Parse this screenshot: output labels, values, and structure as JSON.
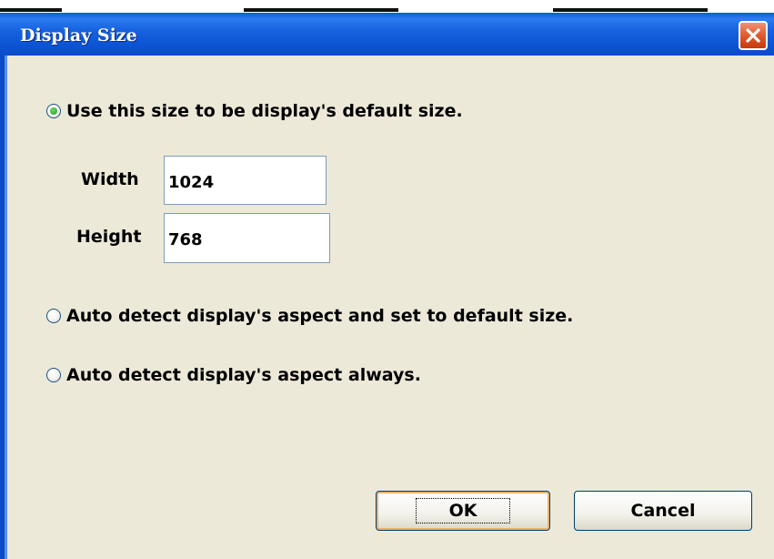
{
  "dialog": {
    "title": "Display Size",
    "close_icon": "close-icon"
  },
  "options": {
    "use_size_label": "Use this size to be display's default size.",
    "auto_default_label": "Auto detect display's aspect and set to default size.",
    "auto_always_label": "Auto detect display's aspect  always.",
    "selected": "use_size"
  },
  "size": {
    "width_label": "Width",
    "width_value": "1024",
    "height_label": "Height",
    "height_value": "768"
  },
  "buttons": {
    "ok_label": "OK",
    "cancel_label": "Cancel"
  },
  "colors": {
    "titlebar": "#0a5ad8",
    "dialog_bg": "#ece9d8",
    "close_button": "#e05a2e",
    "radio_selected": "#21a121"
  }
}
